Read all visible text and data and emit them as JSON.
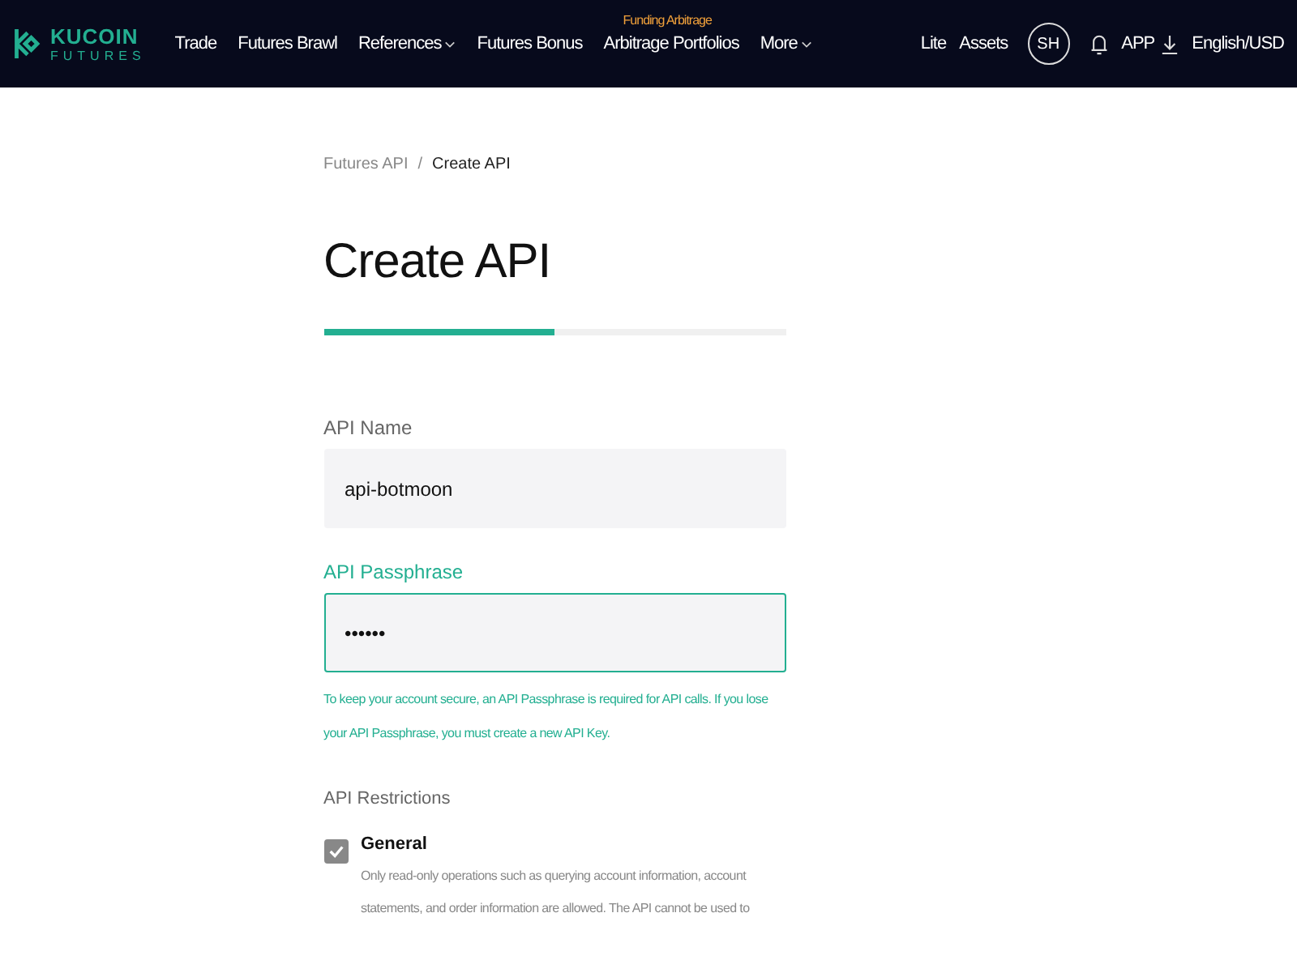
{
  "header": {
    "logo": {
      "name": "KUCOIN",
      "sub": "FUTURES"
    },
    "nav": [
      {
        "label": "Trade",
        "dropdown": false
      },
      {
        "label": "Futures Brawl",
        "dropdown": false
      },
      {
        "label": "References",
        "dropdown": true
      },
      {
        "label": "Futures Bonus",
        "dropdown": false
      },
      {
        "label": "Arbitrage Portfolios",
        "dropdown": false,
        "badge": "Funding Arbitrage"
      },
      {
        "label": "More",
        "dropdown": true
      }
    ],
    "right": {
      "lite": "Lite",
      "assets": "Assets",
      "avatar": "SH",
      "app": "APP",
      "language": "English/USD"
    }
  },
  "breadcrumb": [
    {
      "label": "Futures API"
    },
    {
      "label": "Create API"
    }
  ],
  "breadcrumb_separator": "/",
  "title": "Create API",
  "progress": {
    "level": 0.5
  },
  "form": {
    "fields": [
      {
        "label": "API Name",
        "value": "api-botmoon",
        "focused": false
      },
      {
        "label": "API Passphrase",
        "value": "••••••",
        "focused": true
      }
    ],
    "hint": "To keep your account secure, an API Passphrase is required for API calls. If you lose your API Passphrase, you must create a new API Key.",
    "restrictions_label": "API Restrictions",
    "restrictions": [
      {
        "label": "General",
        "checked": true,
        "description": "Only read-only operations such as querying account information, account statements, and order information are allowed. The API cannot be used to"
      }
    ]
  }
}
